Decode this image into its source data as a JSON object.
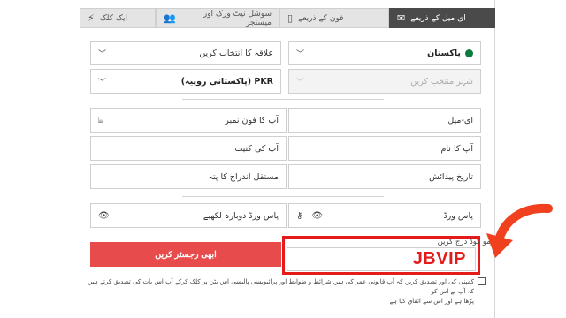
{
  "tabs": [
    {
      "label": "ای میل کے ذریعے",
      "icon": "envelope-icon",
      "active": true
    },
    {
      "label": "فون کے ذریعے",
      "icon": "phone-icon",
      "active": false
    },
    {
      "label": "سوشل نیٹ ورک اور میسنجر",
      "icon": "users-icon",
      "active": false
    },
    {
      "label": "ایک کلک",
      "icon": "lightning-icon",
      "active": false
    }
  ],
  "form": {
    "country": "پاکستان",
    "region_placeholder": "علاقہ کا انتخاب کریں",
    "city_placeholder": "شہر منتخب کریں",
    "currency": "PKR (پاکستانی روپیہ)",
    "email_placeholder": "ای-میل",
    "phone_placeholder": "آپ کا فون نمبر",
    "name_placeholder": "آپ کا نام",
    "surname_placeholder": "آپ کی کنیت",
    "birthdate_placeholder": "تاریخ پیدائش",
    "address_placeholder": "مستقل اندراج کا پتہ",
    "password_placeholder": "پاس ورڈ",
    "password_repeat_placeholder": "پاس ورڈ دوبارہ لکھیے"
  },
  "promo": {
    "label": "پرومو کوڈ درج کریں",
    "code": "JBVIP"
  },
  "register_button": "ابھی رجسٹر کریں",
  "terms": {
    "line1": "کمپنی کی اور تصدیق کریں کہ آپ قانونی عمر کی ہیں شرائط و ضوابط اور پرائیویسی پالیسی اس بٹن پر کلک کرکے آپ اس بات کی تصدیق کرتے ہیں کہ آپ نے اس کو",
    "line2": "پڑھا ہے اور اس سے اتفاق کیا ہے"
  },
  "colors": {
    "accent_red": "#e31b1b",
    "button_red": "#e84b4b",
    "tab_active": "#4a4a4a"
  }
}
